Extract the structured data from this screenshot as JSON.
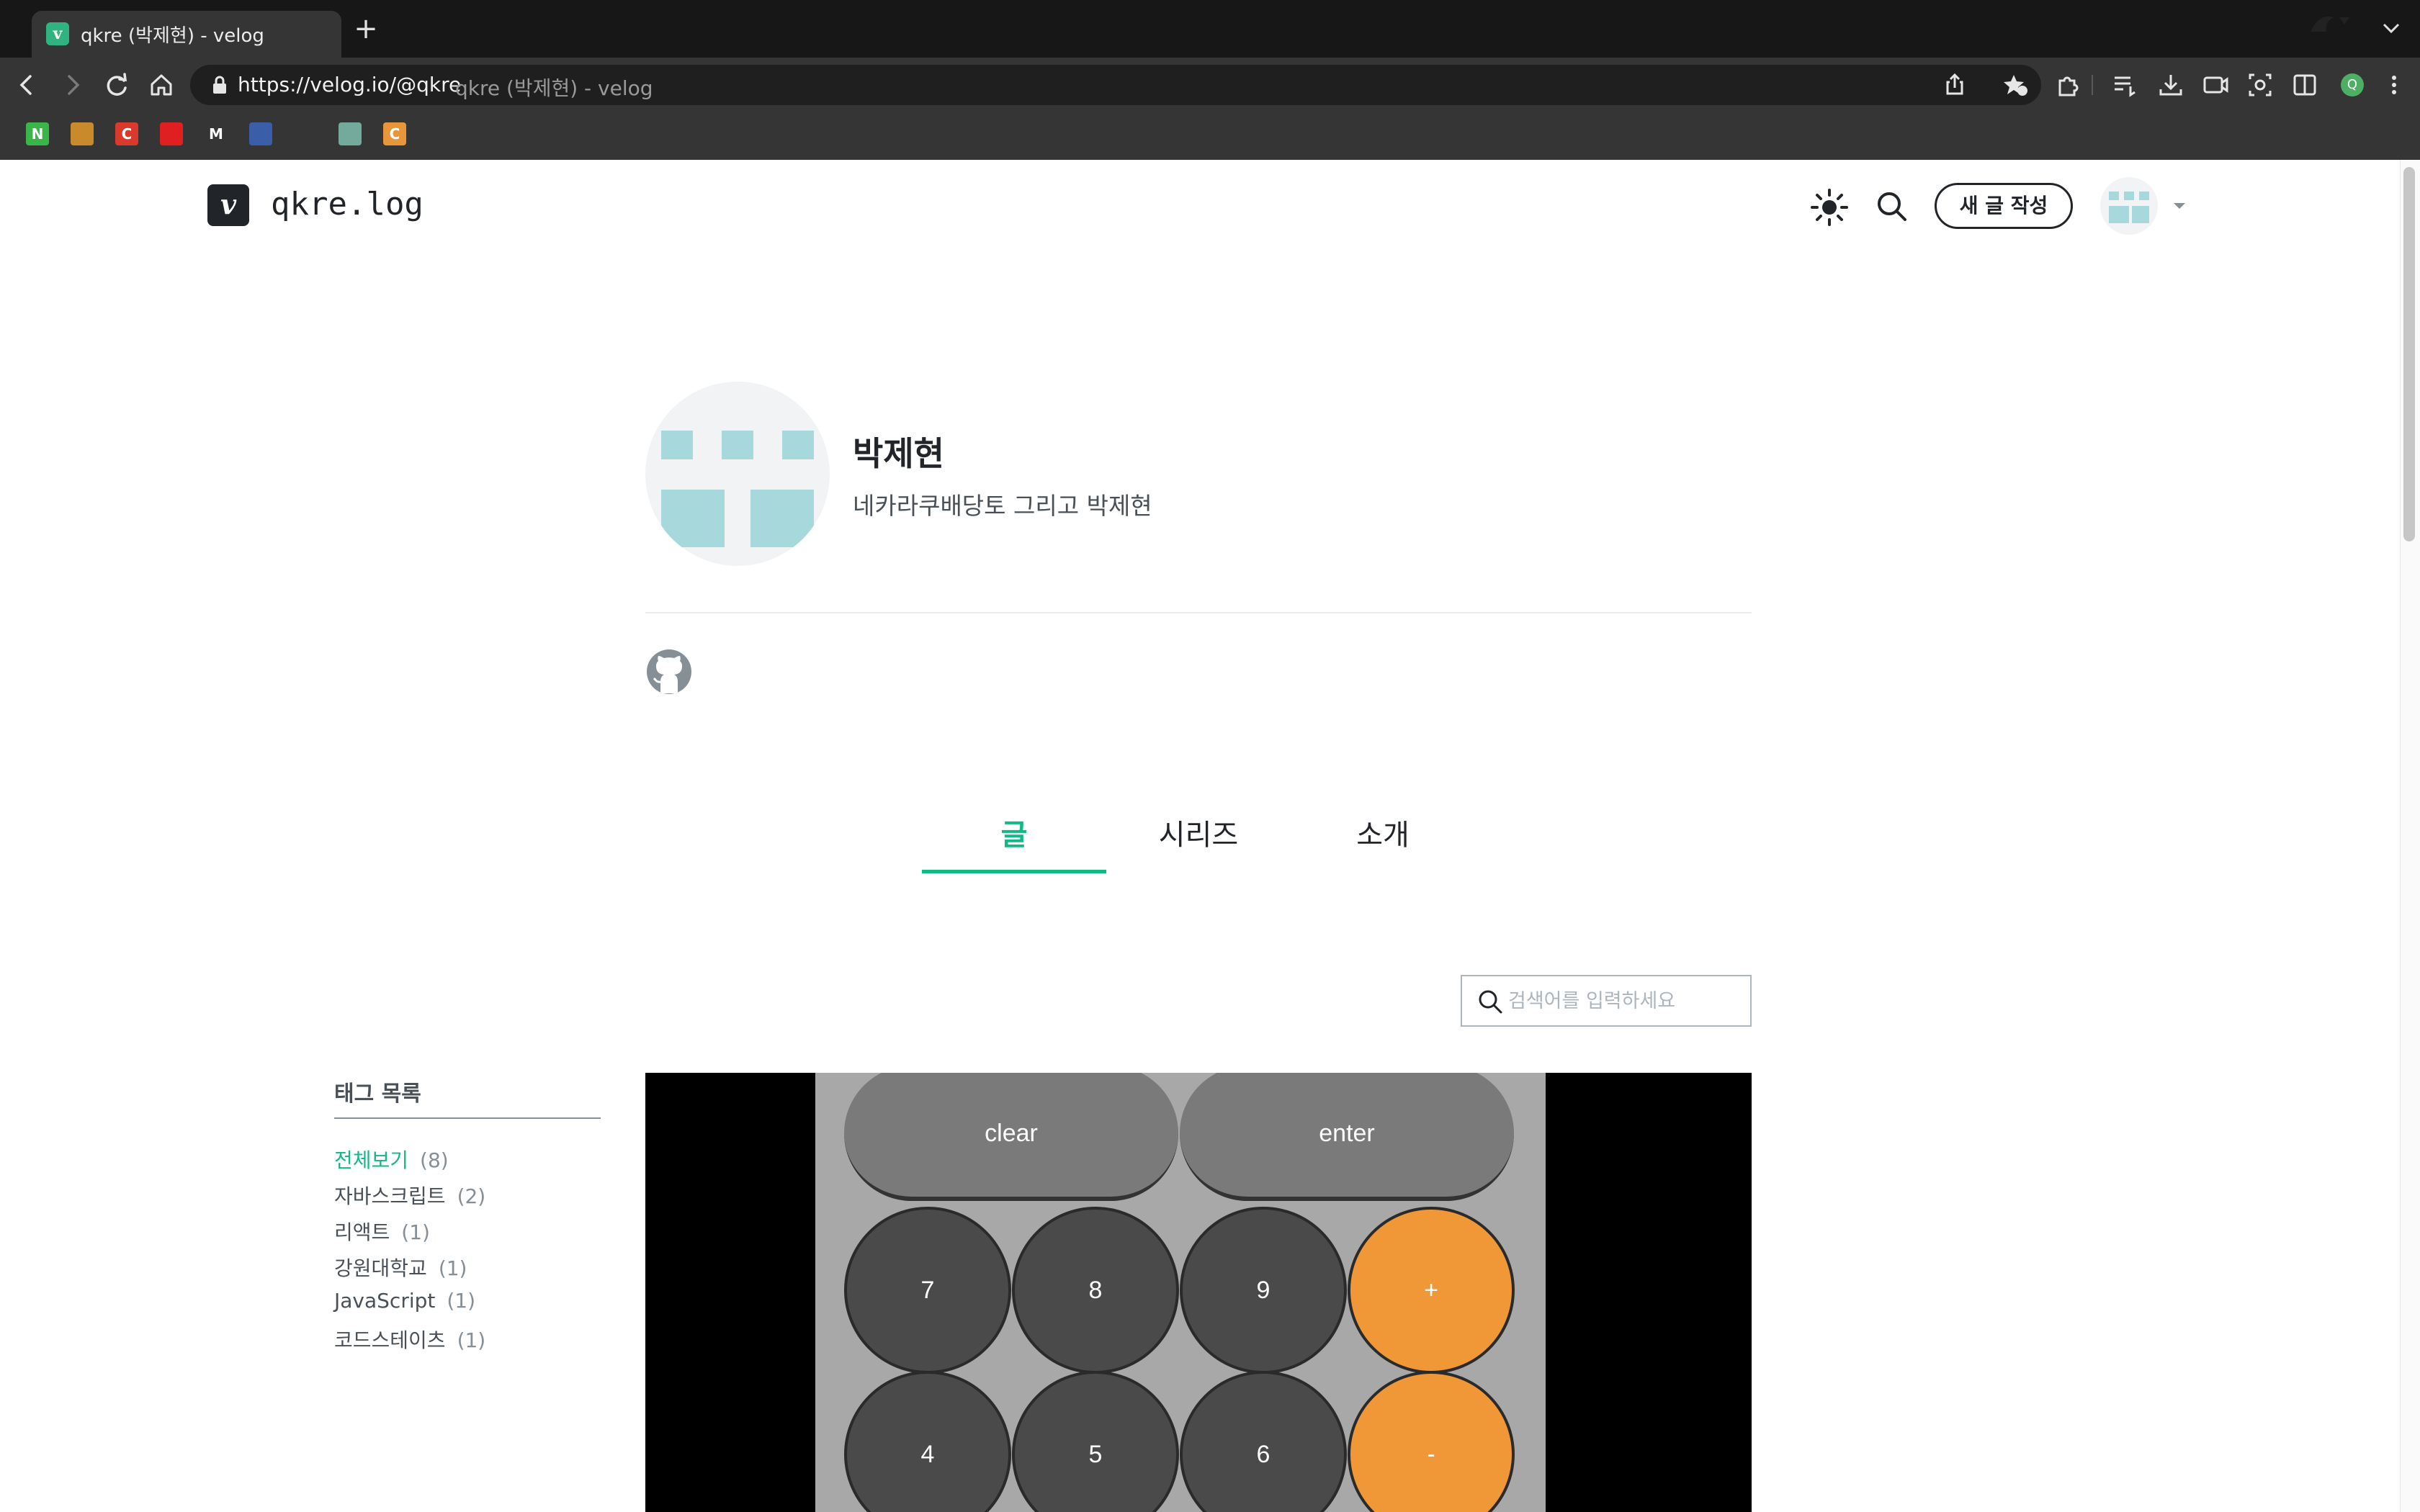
{
  "browser": {
    "tab_title": "qkre (박제현) - velog",
    "tab_favicon": "v",
    "new_tab": "+",
    "url": "https://velog.io/@qkre",
    "url_page_title": "qkre (박제현) - velog",
    "profile_initial": "Q",
    "bookmarks": [
      {
        "icon": "n-bookmark-icon",
        "glyph": "N",
        "color": "#3ab54a"
      },
      {
        "icon": "bee-bookmark-icon",
        "glyph": "",
        "color": "#c98a2b"
      },
      {
        "icon": "c-red-bookmark-icon",
        "glyph": "C",
        "color": "#d93a2b"
      },
      {
        "icon": "youtube-bookmark-icon",
        "glyph": "",
        "color": "#e02020"
      },
      {
        "icon": "gmail-bookmark-icon",
        "glyph": "M",
        "color": "#353535"
      },
      {
        "icon": "globe-bookmark-icon",
        "glyph": "",
        "color": "#3a5fa8"
      },
      {
        "icon": "arc-bookmark-icon",
        "glyph": "",
        "color": "#353535"
      },
      {
        "icon": "chatgpt-bookmark-icon",
        "glyph": "",
        "color": "#74aa9c"
      },
      {
        "icon": "c-orange-bookmark-icon",
        "glyph": "C",
        "color": "#e8963a"
      }
    ]
  },
  "header": {
    "logo": "v",
    "blog_title": "qkre.log",
    "new_post_label": "새 글 작성"
  },
  "profile": {
    "name": "박제현",
    "bio": "네카라쿠배당토 그리고 박제현"
  },
  "tabs": [
    {
      "label": "글",
      "active": true
    },
    {
      "label": "시리즈",
      "active": false
    },
    {
      "label": "소개",
      "active": false
    }
  ],
  "search": {
    "placeholder": "검색어를 입력하세요"
  },
  "tags": {
    "heading": "태그 목록",
    "items": [
      {
        "label": "전체보기",
        "count": "(8)",
        "active": true
      },
      {
        "label": "자바스크립트",
        "count": "(2)",
        "active": false
      },
      {
        "label": "리액트",
        "count": "(1)",
        "active": false
      },
      {
        "label": "강원대학교",
        "count": "(1)",
        "active": false
      },
      {
        "label": "JavaScript",
        "count": "(1)",
        "active": false
      },
      {
        "label": "코드스테이츠",
        "count": "(1)",
        "active": false
      }
    ]
  },
  "thumbnail": {
    "keys": {
      "clear": "clear",
      "enter": "enter",
      "k7": "7",
      "k8": "8",
      "k9": "9",
      "plus": "+",
      "k4": "4",
      "k5": "5",
      "k6": "6",
      "minus": "-"
    }
  },
  "colors": {
    "accent": "#12b886",
    "calculator_orange": "#f09837",
    "avatar_teal": "#a6d8dc"
  }
}
